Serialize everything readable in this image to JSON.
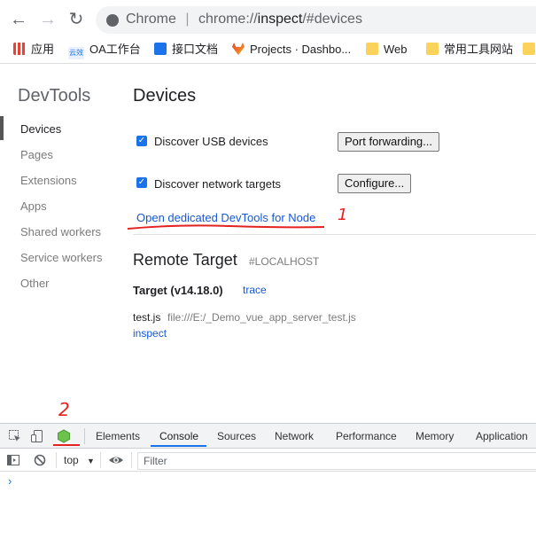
{
  "browser": {
    "omnibox": {
      "site_label": "Chrome",
      "separator": "|",
      "url_prefix": "chrome://",
      "url_host": "inspect",
      "url_suffix": "/#devices"
    },
    "bookmarks": [
      {
        "label": "应用",
        "icon": "apps-grid-icon"
      },
      {
        "label": "OA工作台",
        "icon": "oa-logo-icon"
      },
      {
        "label": "接口文档",
        "icon": "doc-icon"
      },
      {
        "label": "Projects · Dashbo...",
        "icon": "gitlab-icon"
      },
      {
        "label": "Web",
        "icon": "folder-icon"
      },
      {
        "label": "常用工具网站",
        "icon": "folder-icon"
      }
    ]
  },
  "nav": {
    "title": "DevTools",
    "items": [
      "Devices",
      "Pages",
      "Extensions",
      "Apps",
      "Shared workers",
      "Service workers",
      "Other"
    ]
  },
  "devices": {
    "title": "Devices",
    "usb_label": "Discover USB devices",
    "network_label": "Discover network targets",
    "port_forwarding_button": "Port forwarding...",
    "configure_button": "Configure...",
    "open_node_link": "Open dedicated DevTools for Node"
  },
  "remote": {
    "title": "Remote Target",
    "host": "#LOCALHOST",
    "target_name": "Target (v14.18.0)",
    "trace_link": "trace",
    "file_name": "test.js",
    "file_path": "file:///E:/_Demo_vue_app_server_test.js",
    "inspect_link": "inspect"
  },
  "devtools": {
    "tabs": [
      "Elements",
      "Console",
      "Sources",
      "Network",
      "Performance",
      "Memory",
      "Application"
    ],
    "active_tab": "Console",
    "context": "top",
    "filter_placeholder": "Filter",
    "prompt": "›"
  },
  "annotations": {
    "mark1": "1",
    "mark2": "2"
  },
  "colors": {
    "accent": "#1a73e8",
    "link": "#1558d6",
    "annotation": "#e52222",
    "node_icon": "#6cc24a"
  }
}
